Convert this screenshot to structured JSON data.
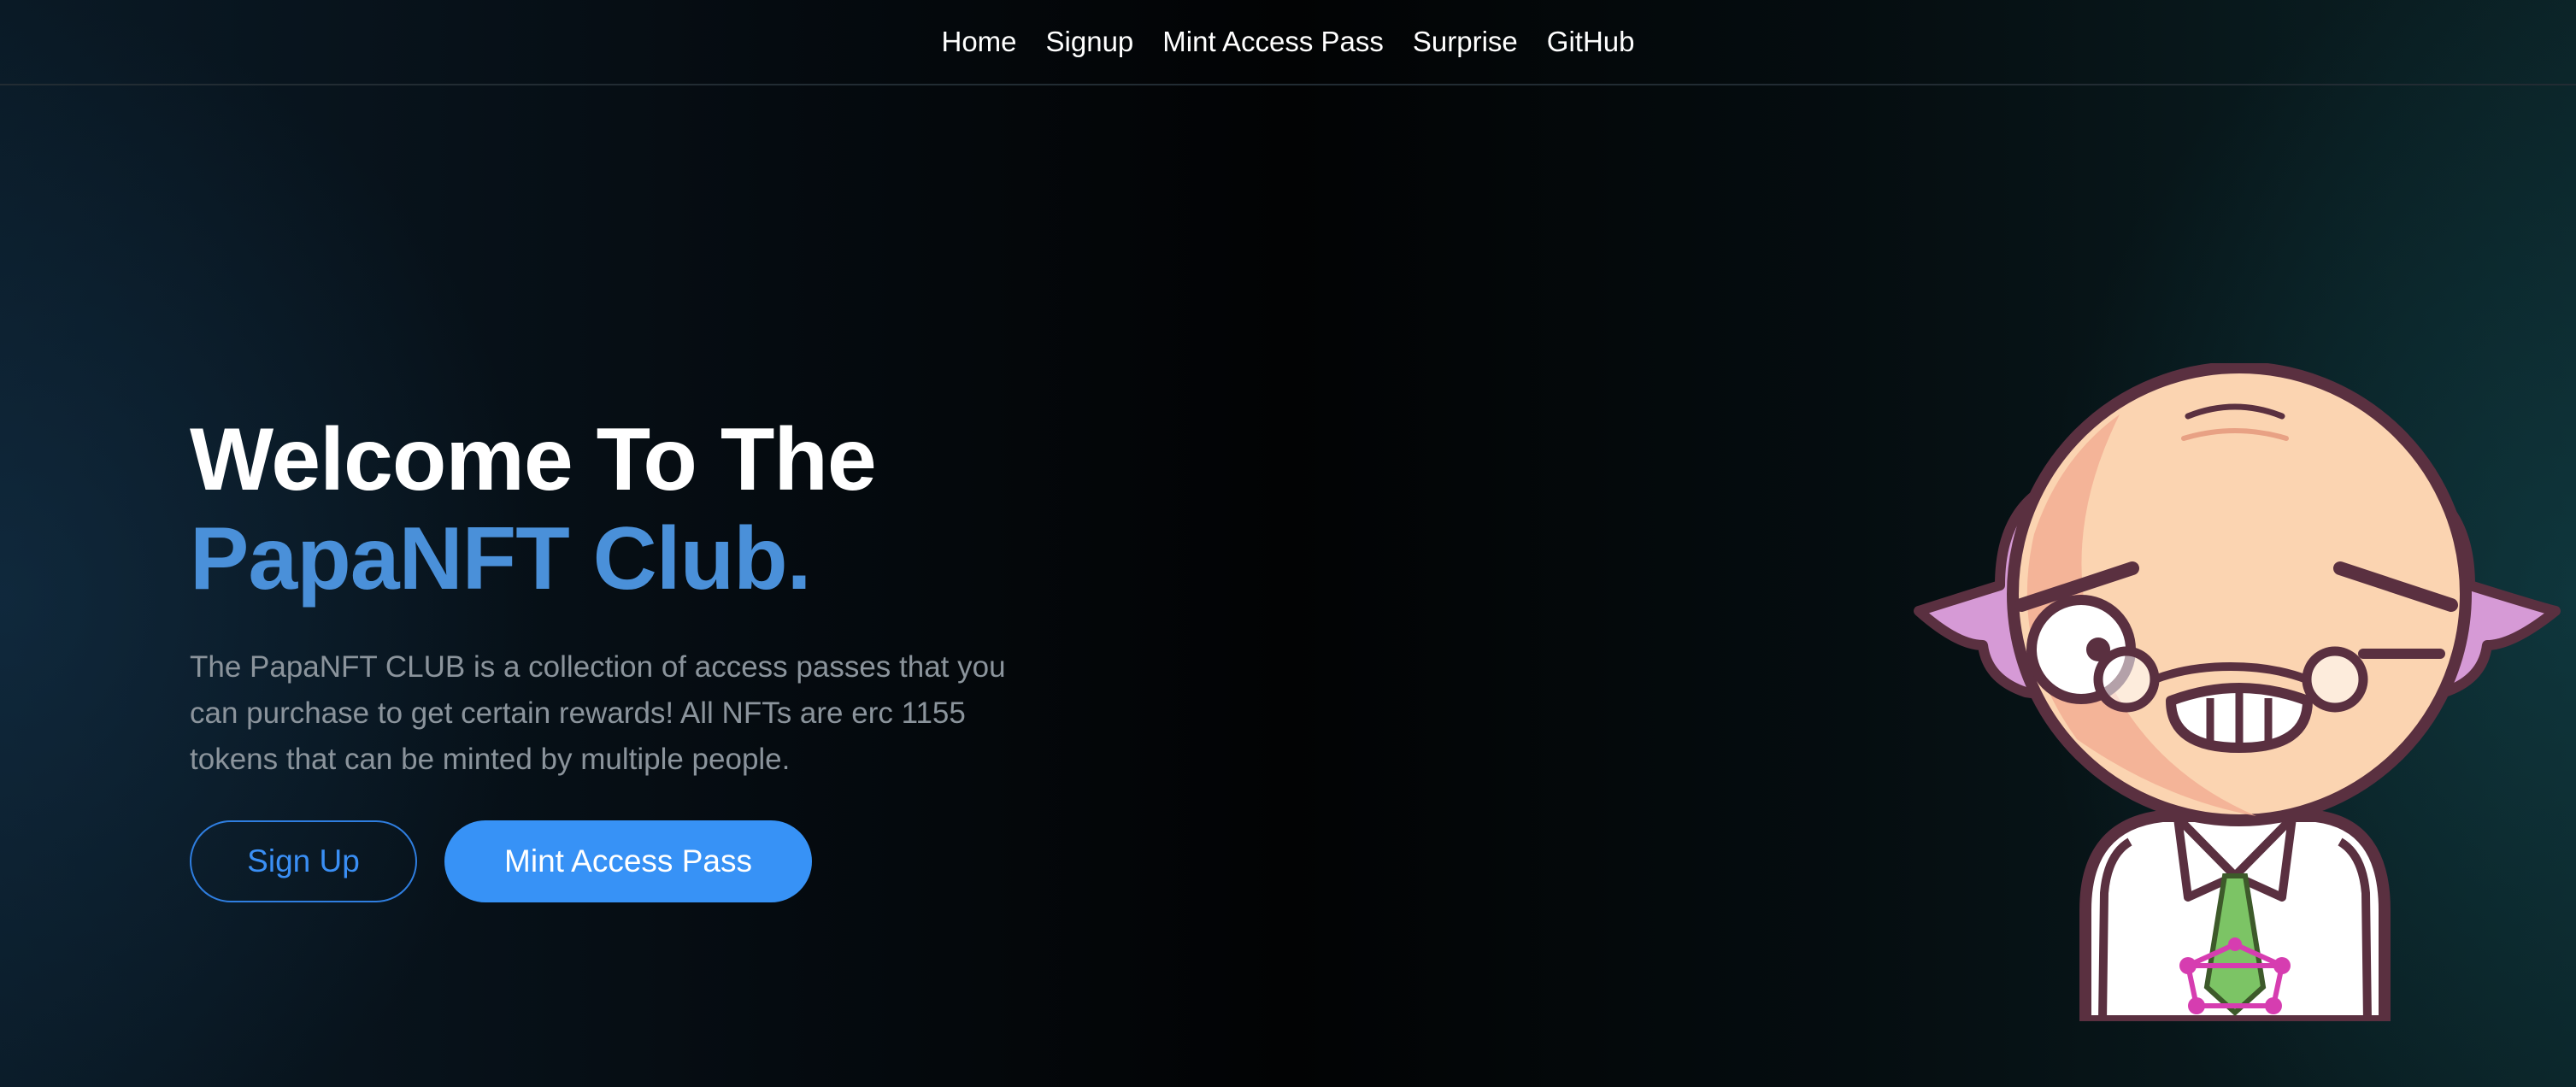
{
  "nav": {
    "items": [
      {
        "label": "Home"
      },
      {
        "label": "Signup"
      },
      {
        "label": "Mint Access Pass"
      },
      {
        "label": "Surprise"
      },
      {
        "label": "GitHub"
      }
    ]
  },
  "hero": {
    "title_line1": "Welcome To The",
    "title_line2": "PapaNFT Club.",
    "description": "The PapaNFT CLUB is a collection of access passes that you can purchase to get certain rewards! All NFTs are erc 1155 tokens that can be minted by multiple people.",
    "signup_label": "Sign Up",
    "mint_label": "Mint Access Pass"
  },
  "colors": {
    "accent": "#3792f6",
    "title_highlight": "#4a90d9",
    "background": "#05080c"
  },
  "icons": {
    "mascot": "papa-nft-mascot"
  }
}
